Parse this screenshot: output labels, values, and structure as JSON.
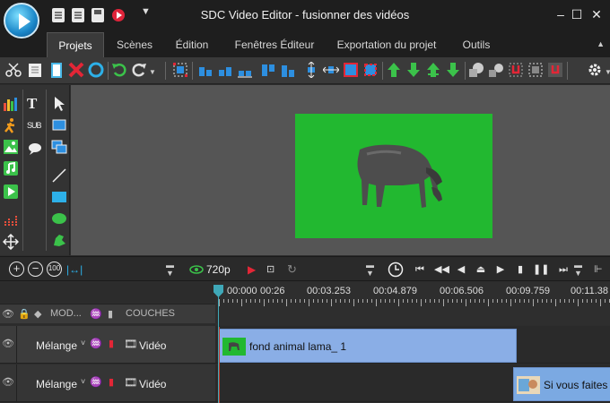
{
  "window": {
    "title": "SDC Video Editor - fusionner des vidéos"
  },
  "ribbon_tabs": [
    {
      "label": "Projets"
    },
    {
      "label": "Scènes"
    },
    {
      "label": "Édition"
    },
    {
      "label": "Fenêtres Éditeur"
    },
    {
      "label": "Exportation du projet"
    },
    {
      "label": "Outils"
    }
  ],
  "active_tab": "Projets",
  "transport": {
    "resolution": "720p"
  },
  "ruler": {
    "ticks": [
      "00:000",
      "00:26",
      "00:03.253",
      "00:04.879",
      "00:06.506",
      "00:09.759",
      "00:11.38"
    ]
  },
  "columns": {
    "mode": "MOD...",
    "layers": "COUCHES"
  },
  "tracks": [
    {
      "blend": "Mélange",
      "type": "Vidéo",
      "clip": "fond animal lama_ 1"
    },
    {
      "blend": "Mélange",
      "type": "Vidéo",
      "clip": "Si vous faites c"
    }
  ],
  "colors": {
    "canvas_green": "#22b830",
    "clip_blue": "#8aaee6",
    "playhead": "#3fa8b8"
  }
}
